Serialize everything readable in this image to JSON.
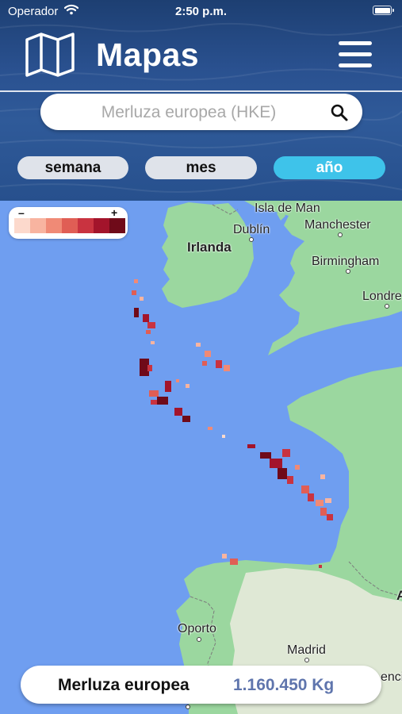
{
  "status_bar": {
    "carrier": "Operador",
    "time": "2:50 p.m."
  },
  "header": {
    "title": "Mapas",
    "icons": {
      "left": "folded-map-icon",
      "right": "hamburger-menu-icon"
    }
  },
  "search": {
    "placeholder": "Merluza europea (HKE)",
    "value": "",
    "icon": "search-icon"
  },
  "period_tabs": [
    {
      "label": "semana",
      "selected": false
    },
    {
      "label": "mes",
      "selected": false
    },
    {
      "label": "año",
      "selected": true
    }
  ],
  "legend": {
    "min_label": "–",
    "max_label": "+",
    "colors": [
      "#fcd9cc",
      "#f8b4a0",
      "#f08a76",
      "#e05e55",
      "#c93340",
      "#a3142b",
      "#6f0a19"
    ]
  },
  "map": {
    "labels": {
      "isle_of_man": "Isla de Man",
      "dublin": "Dublín",
      "manchester": "Manchester",
      "ireland": "Irlanda",
      "birmingham": "Birmingham",
      "london": "Londre",
      "porto": "Oporto",
      "madrid": "Madrid",
      "valencia": "encia",
      "edge_a": "A"
    },
    "colors": {
      "sea": "#6f9ef0",
      "land": "#9bd79f",
      "land_dry": "#dfe8d5"
    }
  },
  "summary": {
    "species": "Merluza europea",
    "amount": "1.160.450 Kg"
  }
}
